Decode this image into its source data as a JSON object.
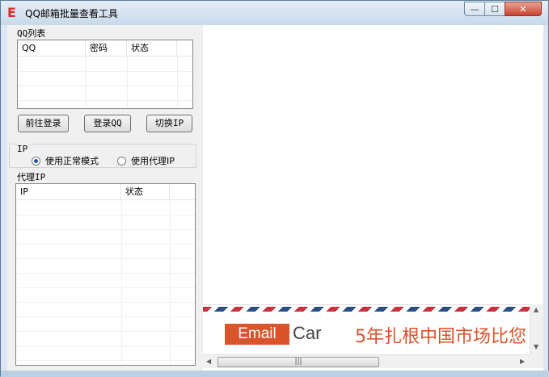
{
  "window": {
    "title": "QQ邮箱批量查看工具",
    "app_icon_letter": "E",
    "min_symbol": "—",
    "max_symbol": "☐",
    "close_symbol": "✕"
  },
  "qq_list": {
    "label": "QQ列表",
    "columns": [
      "QQ",
      "密码",
      "状态"
    ],
    "rows": []
  },
  "buttons": {
    "go_login": "前往登录",
    "login_qq": "登录QQ",
    "switch_ip": "切换IP"
  },
  "ip_mode": {
    "label": "IP",
    "options": [
      {
        "label": "使用正常模式",
        "selected": true
      },
      {
        "label": "使用代理IP",
        "selected": false
      }
    ]
  },
  "proxy_list": {
    "label": "代理IP",
    "columns": [
      "IP",
      "状态"
    ],
    "rows": []
  },
  "banner": {
    "logo_email": "Email",
    "logo_car": "Car",
    "slogan": "5年扎根中国市场比您"
  },
  "hscroll": {
    "left_arrow": "◀",
    "right_arrow": "▶",
    "grip": "|||"
  },
  "vscroll": {
    "up_arrow": "▲",
    "down_arrow": "▼"
  },
  "colors": {
    "accent_orange": "#d9532b",
    "stripe_red": "#c8323c",
    "stripe_blue": "#2b4f84"
  }
}
